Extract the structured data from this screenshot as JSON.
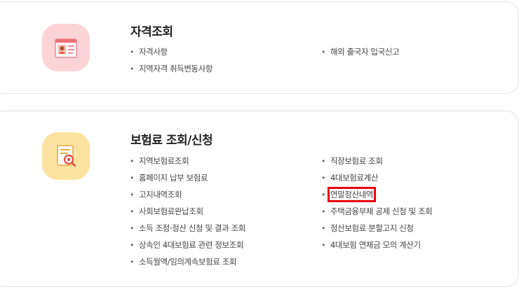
{
  "colors": {
    "highlight_border": "#e60012",
    "icon1_bg": "#fcd3d6",
    "icon2_bg": "#fde3a2"
  },
  "qualification": {
    "icon": "id-card-icon",
    "title": "자격조회",
    "left_items": [
      "자격사항",
      "지역자격 취득변동사항"
    ],
    "right_items": [
      "해외 출국자 입국신고"
    ]
  },
  "premium": {
    "icon": "document-search-icon",
    "title": "보험료 조회/신청",
    "left_items": [
      "지역보험료조회",
      "홈페이지 납부 보험료",
      "고지내역조회",
      "사회보험료완납조회",
      "소득 조정·정산 신청 및 결과 조회",
      "상속인 4대보험료 관련 정보조회",
      "소득월액/임의계속보험료 조회"
    ],
    "right_items": [
      "직장보험료 조회",
      "4대보험료계산",
      "연말정산내역",
      "주택금융부채 공제 신청 및 조회",
      "정산보험료 분할고지 신청",
      "4대보험 연체금 모의 계산기"
    ]
  }
}
